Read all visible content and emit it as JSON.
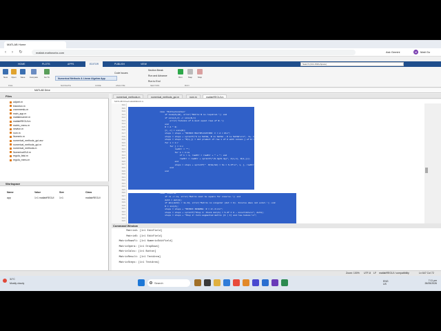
{
  "browser": {
    "tab_title": "MATLAB Home",
    "url": "matlab.mathworks.com",
    "ask_gemini": "Ask Gemini",
    "profile_initial": "M",
    "profile_label": "Matt Go"
  },
  "matlab": {
    "tabs": [
      "HOME",
      "PLOTS",
      "APPS",
      "EDITOR",
      "PUBLISH",
      "VIEW"
    ],
    "active_tab": "EDITOR",
    "search_placeholder": "Search (Ctrl+Shift+Space)",
    "ribbon": {
      "buttons": [
        "New",
        "Open",
        "Save",
        "Compare",
        "Go To",
        "Find"
      ],
      "app_title": "Numerical Methods & Linear Algebra App",
      "code_issues": "Code Issues",
      "section_break": "Section Break",
      "run_and_advance": "Run and Advance",
      "run_to_end": "Run to End",
      "run": "Run",
      "step": "Step",
      "stop": "Stop",
      "group_labels": [
        "FILE",
        "NAVIGATE",
        "CODE",
        "ANALYZE",
        "SECTION",
        "RUN"
      ]
    },
    "path": "MATLAB Drive"
  },
  "files": {
    "title": "Files",
    "items": [
      "adjoint.m",
      "bisection.m",
      "crammerslu.m",
      "main_app.m",
      "matlabnumeri.m",
      "matlabREGUI.m",
      "matrix_menu.m",
      "newton.m",
      "num.m",
      "Numeric.m",
      "numerical_methods_gui.asv",
      "numerical_methods_gui.m",
      "numerical_methods.m",
      "NumericalGUI.m",
      "regula_falsi.m",
      "regula_menu.m"
    ]
  },
  "workspace": {
    "title": "Workspace",
    "headers": [
      "Name",
      "Value",
      "Size",
      "Class"
    ],
    "row": {
      "name": "app",
      "value": "1×1 matlabREGUI",
      "size": "1×1",
      "class": "matlabREGUI"
    }
  },
  "editor": {
    "tabs": [
      "numerical_methods.m",
      "numerical_methods_gui.m",
      "num.m",
      "matlabREGUI.m"
    ],
    "active_tab": "matlabREGUI.m",
    "path": "MATLAB Drive/matlabREGUI.m",
    "line_numbers": [
      "608",
      "609",
      "610",
      "611",
      "612",
      "613",
      "614",
      "615",
      "616",
      "617",
      "618",
      "619",
      "620",
      "621",
      "622",
      "623",
      "624",
      "625",
      "626",
      "627",
      "628",
      "629",
      "630",
      "631",
      "632",
      "633",
      "634",
      "635",
      "636",
      "637",
      "638",
      "639",
      "640",
      "641",
      "642",
      "643",
      "644",
      "645"
    ],
    "lines_sel1": [
      "case 'Multiplication'",
      "    if isempty(B), error('Matrix B is required.'); end",
      "    if size(A,2) ~= size(B,1)",
      "        error('Columns of A must equal rows of B.');",
      "    end",
      "    R = A * B;",
      "    [r, c] = size(R);",
      "    steps = steps + \"MATRIX MULTIPLICATION: C = A × B\\n\";",
      "    steps = steps + sprintf(\"A is %d×%d, B is %d×%d → R is %d×%d\\n\\n\", ra, ca, rb, cb, r, c);",
      "    steps = steps + \"R(i,j) = dot product of row i of A with column j of B:\\n\\n\";",
      "    for i = 1:r",
      "        for j = 1:c",
      "            rowStr = \"\";",
      "            for k = 1:ca",
      "                if k > 1, rowStr = rowStr + \" + \"; end",
      "                rowStr = rowStr + sprintf(\"(%.4g×%.4g)\", A(i,k), B(k,j));",
      "            end",
      "            steps = steps + sprintf(\"  R(%d,%d) = %s = %.4f\\n\", i, j, rowStr, R(i,j));",
      "        end",
      "    end"
    ],
    "lines_sel2": [
      "case 'Inverse'",
      "    if ra ~= ca, error('Matrix must be square for inverse.'); end",
      "    detA = det(A);",
      "    if abs(detA) < 1e-12, error('Matrix is singular (det = 0). Inverse does not exist.'); end",
      "    R = inv(A);",
      "    steps = steps + \"MATRIX INVERSE: R = A^-1\\n\\n\";",
      "    steps = steps + sprintf(\"Step 1: Check det(A) = %.4f ≠ 0 → invertible\\n\", detA);",
      "    steps = steps + \"Step 2: Form augmented matrix [A | I] and row-reduce:\\n\";"
    ]
  },
  "command_window": {
    "title": "Command Window",
    "lines": [
      "         MatrixA: [1×1 EditField]",
      "         MatrixB: [1×1 EditField]",
      "    MatrixRowsFi: [1×1 NumericEditField]",
      "    MatrixOpera: [1×1 DropDown]",
      "    MatrixCalcu: [1×1 Button]",
      "    MatrixResult: [1×1 TextArea]",
      "    MatrixSteps: [1×1 TextArea]"
    ]
  },
  "statusbar": {
    "zoom": "Zoom: 100%",
    "encoding": "UTF-8",
    "eol": "LF",
    "file_type": "matlabREGUI / compatibility",
    "position": "Ln 647  Col 72"
  },
  "taskbar": {
    "weather_temp": "31°C",
    "weather_desc": "Mostly cloudy",
    "search": "Search",
    "lang": "ENG",
    "region": "US",
    "time": "7:11 pm",
    "date": "26/05/2026"
  }
}
